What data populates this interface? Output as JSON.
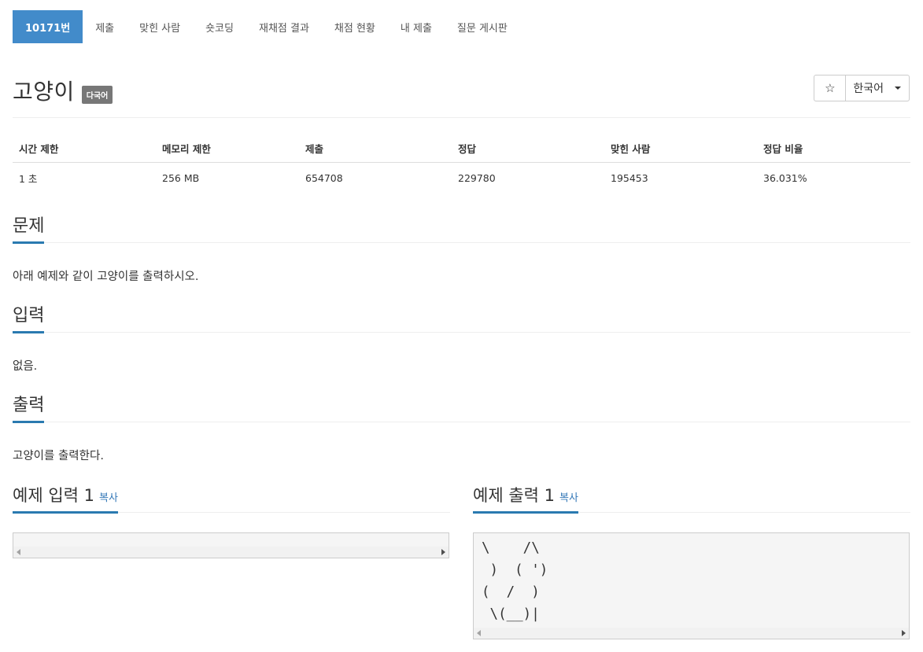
{
  "tabs": [
    {
      "label": "10171번",
      "active": true
    },
    {
      "label": "제출"
    },
    {
      "label": "맞힌 사람"
    },
    {
      "label": "숏코딩"
    },
    {
      "label": "재채점 결과"
    },
    {
      "label": "채점 현황"
    },
    {
      "label": "내 제출"
    },
    {
      "label": "질문 게시판"
    }
  ],
  "problem": {
    "title": "고양이",
    "badge": "다국어",
    "star_icon": "☆",
    "language": "한국어"
  },
  "info": {
    "headers": [
      "시간 제한",
      "메모리 제한",
      "제출",
      "정답",
      "맞힌 사람",
      "정답 비율"
    ],
    "values": [
      "1 초",
      "256 MB",
      "654708",
      "229780",
      "195453",
      "36.031%"
    ]
  },
  "sections": {
    "description": {
      "heading": "문제",
      "text": "아래 예제와 같이 고양이를 출력하시오."
    },
    "input": {
      "heading": "입력",
      "text": "없음."
    },
    "output": {
      "heading": "출력",
      "text": "고양이를 출력한다."
    }
  },
  "samples": {
    "input": {
      "heading": "예제 입력 1",
      "copy": "복사",
      "content": ""
    },
    "output": {
      "heading": "예제 출력 1",
      "copy": "복사",
      "content": "\\    /\\\n )  ( ')\n(  /  )\n \\(__)|"
    }
  },
  "colors": {
    "accent": "#428bca",
    "section_underline": "#2a7ab0",
    "link": "#3579b8",
    "badge": "#777777"
  }
}
